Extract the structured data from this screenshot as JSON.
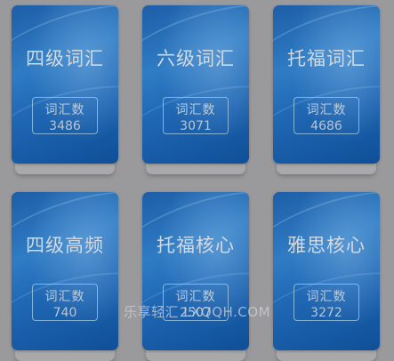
{
  "cards": [
    {
      "title": "四级词汇",
      "count_label": "词汇数",
      "count": "3486"
    },
    {
      "title": "六级词汇",
      "count_label": "词汇数",
      "count": "3071"
    },
    {
      "title": "托福词汇",
      "count_label": "词汇数",
      "count": "4686"
    },
    {
      "title": "四级高频",
      "count_label": "词汇数",
      "count": "740"
    },
    {
      "title": "托福核心",
      "count_label": "词汇数",
      "count": "2507"
    },
    {
      "title": "雅思核心",
      "count_label": "词汇数",
      "count": "3272"
    }
  ],
  "watermark": "乐享轻汇 LXQQH.COM"
}
